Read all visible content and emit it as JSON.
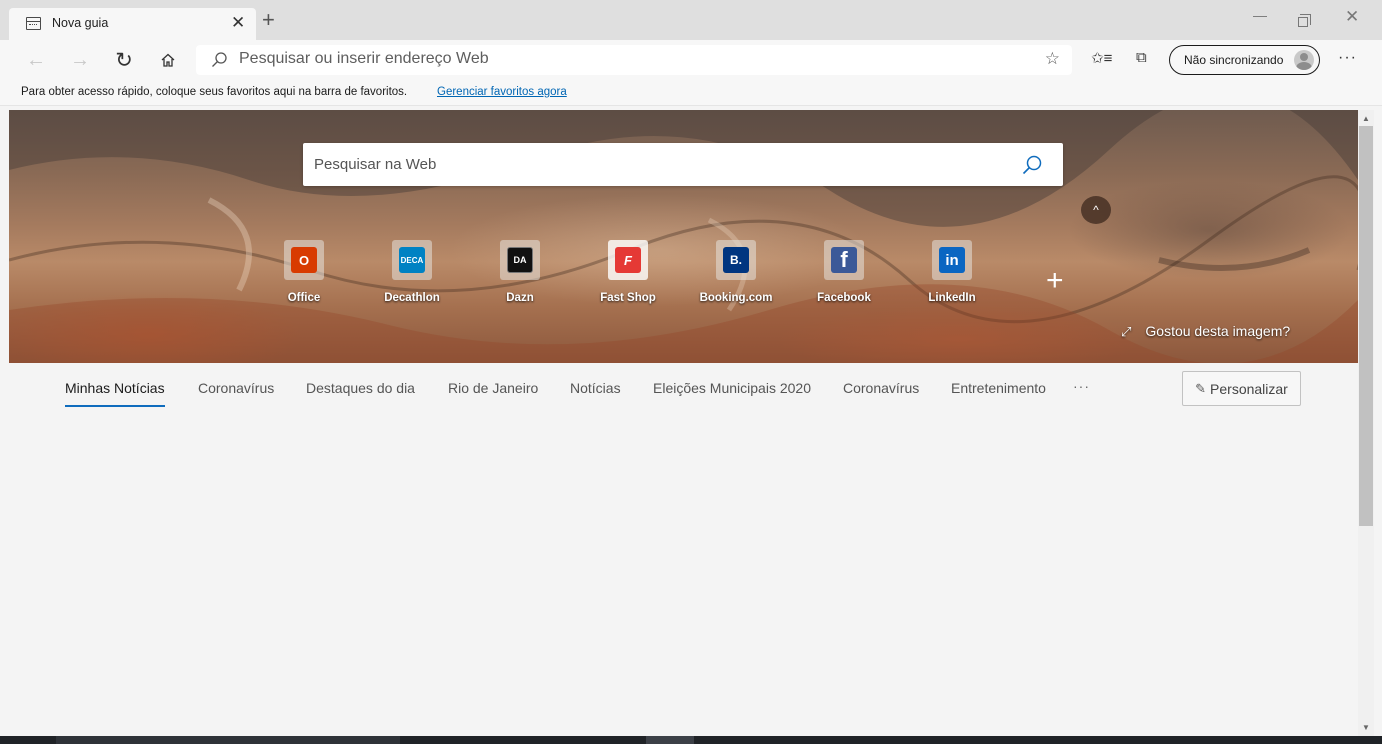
{
  "tab": {
    "title": "Nova guia",
    "close": "✕",
    "new_tab": "+"
  },
  "window": {
    "minimize": "—",
    "close": "✕"
  },
  "toolbar": {
    "back": "←",
    "forward": "→",
    "reload": "↻",
    "home": "⌂",
    "address_placeholder": "Pesquisar ou inserir endereço Web",
    "star": "☆",
    "favorites": "✩≡",
    "collections": "⧉",
    "sync_label": "Não sincronizando",
    "more": "···"
  },
  "favorites_bar": {
    "message": "Para obter acesso rápido, coloque seus favoritos aqui na barra de favoritos.",
    "link": "Gerenciar favoritos agora"
  },
  "hero": {
    "search_placeholder": "Pesquisar na Web",
    "collapse": "^",
    "add_site": "+",
    "liked_icon": "⤢",
    "liked_text": "Gostou desta imagem?"
  },
  "quick_links": [
    {
      "label": "Office",
      "glyph": "O",
      "color": "#d83b01",
      "icon": "office-icon"
    },
    {
      "label": "Decathlon",
      "glyph": "DECA",
      "color": "#0082c3",
      "icon": "decathlon-icon"
    },
    {
      "label": "Dazn",
      "glyph": "DA",
      "color": "#111111",
      "icon": "dazn-icon"
    },
    {
      "label": "Fast Shop",
      "glyph": "F",
      "color": "#e53935",
      "icon": "fastshop-icon"
    },
    {
      "label": "Booking.com",
      "glyph": "B.",
      "color": "#003580",
      "icon": "booking-icon"
    },
    {
      "label": "Facebook",
      "glyph": "f",
      "color": "#3b5998",
      "icon": "facebook-icon"
    },
    {
      "label": "LinkedIn",
      "glyph": "in",
      "color": "#0a66c2",
      "icon": "linkedin-icon"
    }
  ],
  "news_tabs": [
    "Minhas Notícias",
    "Coronavírus",
    "Destaques do dia",
    "Rio de Janeiro",
    "Notícias",
    "Eleições Municipais 2020",
    "Coronavírus",
    "Entretenimento"
  ],
  "news_more": "···",
  "personalize": {
    "pen": "✎",
    "label": "Personalizar"
  },
  "scrollbar": {
    "up": "▲",
    "down": "▼"
  },
  "colors": {
    "accent": "#0f6cbd",
    "link": "#0066b4"
  }
}
